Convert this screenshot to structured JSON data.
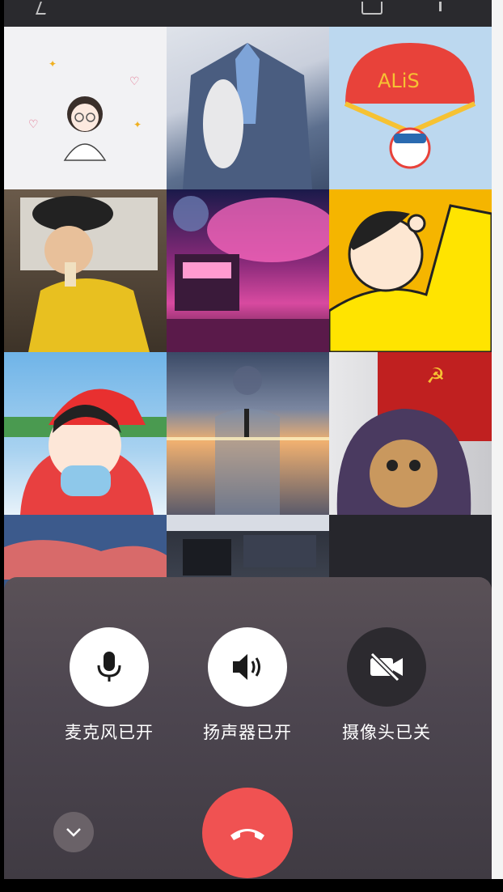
{
  "controls": {
    "mic_label": "麦克风已开",
    "speaker_label": "扬声器已开",
    "camera_label": "摄像头已关"
  },
  "icons": {
    "mic": "microphone-icon",
    "speaker": "speaker-icon",
    "camera": "camera-off-icon",
    "collapse": "chevron-down-icon",
    "hangup": "hang-up-icon"
  },
  "colors": {
    "hangup": "#f05252",
    "on_button": "#ffffff",
    "off_button": "#2c2a2f"
  }
}
